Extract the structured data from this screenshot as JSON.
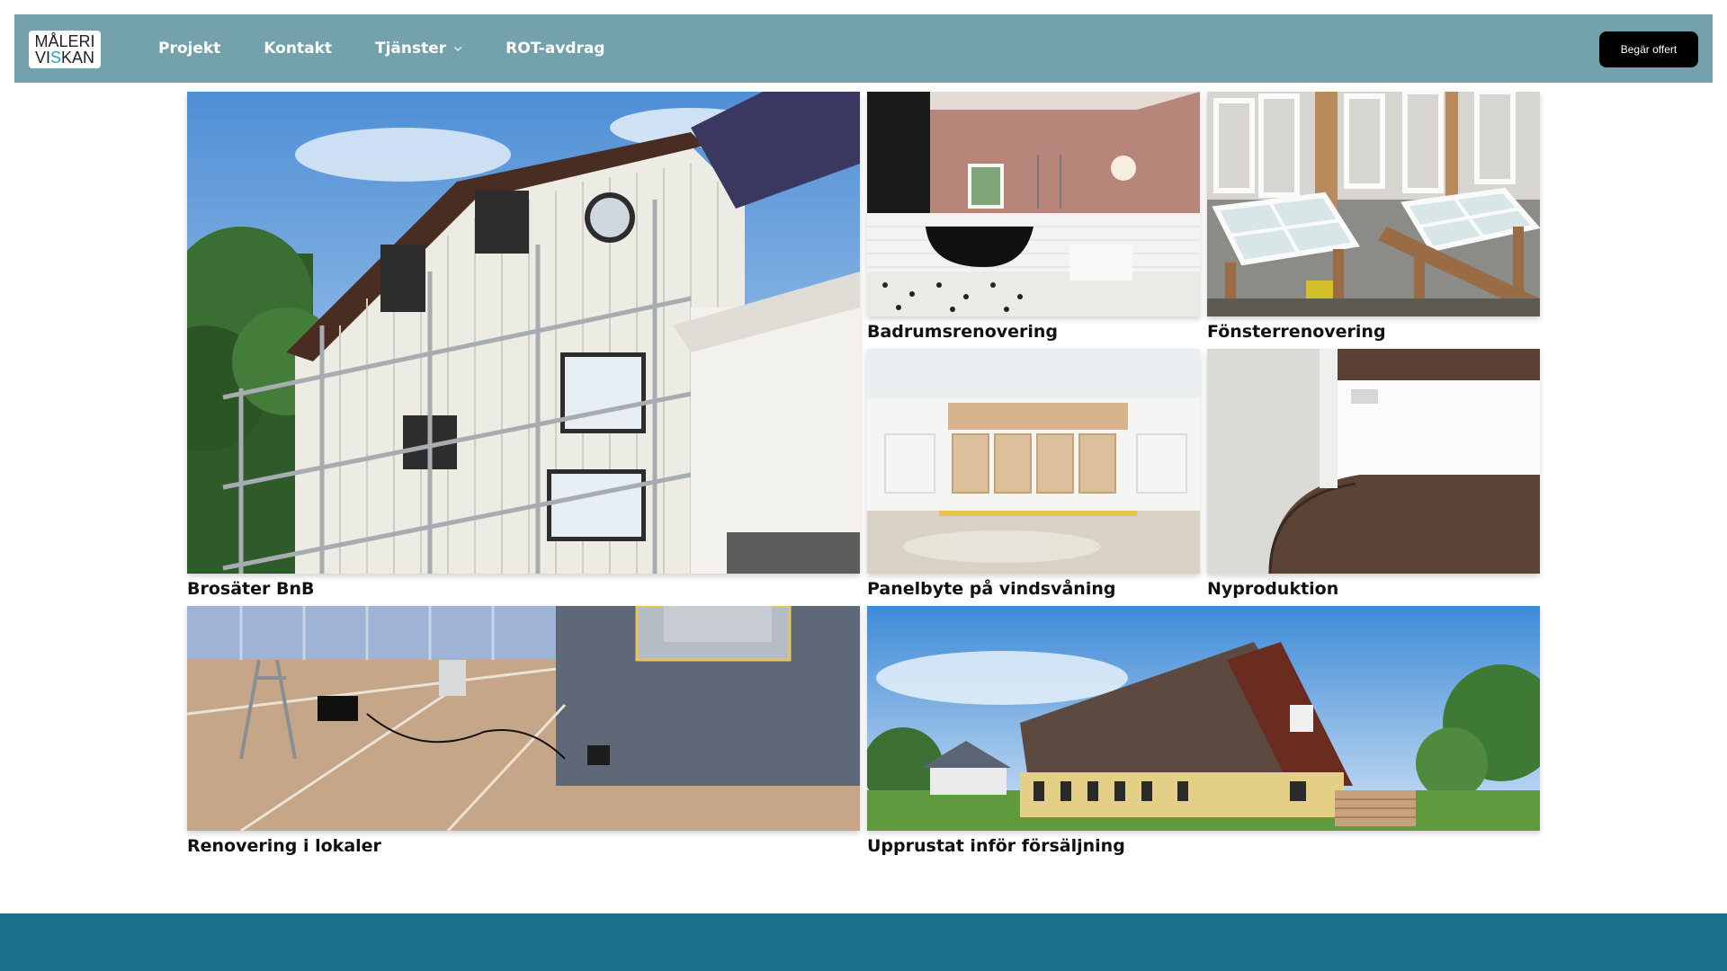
{
  "top_strip": {
    "link_text": "|"
  },
  "brand": {
    "logo_line1": "MÅLERI",
    "logo_line2_a": "VI",
    "logo_line2_b": "S",
    "logo_line2_c": "KAN"
  },
  "nav": {
    "items": [
      {
        "label": "Projekt"
      },
      {
        "label": "Kontakt"
      },
      {
        "label": "Tjänster",
        "icon": "chevron-down-icon"
      },
      {
        "label": "ROT-avdrag"
      }
    ],
    "cta_label": "Begär offert"
  },
  "colors": {
    "nav_bg": "#73a1ac",
    "footer_bg": "#1a7189",
    "cta_bg": "#000000",
    "logo_accent": "#2c9fc0"
  },
  "projects": [
    {
      "title": "Brosäter BnB"
    },
    {
      "title": "Badrumsrenovering"
    },
    {
      "title": "Fönsterrenovering"
    },
    {
      "title": "Panelbyte på vindsvåning"
    },
    {
      "title": "Nyproduktion"
    },
    {
      "title": "Renovering i lokaler"
    },
    {
      "title": "Upprustat inför försäljning"
    }
  ]
}
